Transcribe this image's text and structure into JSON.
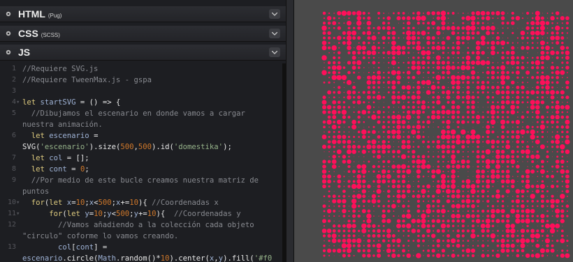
{
  "panels": [
    {
      "title": "HTML",
      "sub": "(Pug)"
    },
    {
      "title": "CSS",
      "sub": "(SCSS)"
    },
    {
      "title": "JS",
      "sub": ""
    }
  ],
  "code_lines": [
    {
      "n": "1",
      "fold": "",
      "tokens": [
        [
          "c",
          "//Requiere SVG.js"
        ]
      ]
    },
    {
      "n": "2",
      "fold": "",
      "tokens": [
        [
          "c",
          "//Requiere TweenMax.js - gspa"
        ]
      ]
    },
    {
      "n": "3",
      "fold": "",
      "tokens": []
    },
    {
      "n": "4",
      "fold": "▾",
      "tokens": [
        [
          "k",
          "let "
        ],
        [
          "v",
          "startSVG"
        ],
        [
          "p",
          " = () => {"
        ]
      ]
    },
    {
      "n": "5",
      "fold": "",
      "tokens": [
        [
          "c",
          "  //Dibujamos el escenario en donde vamos a cargar"
        ]
      ]
    },
    {
      "n": "",
      "fold": "",
      "tokens": [
        [
          "c",
          "nuestra animación."
        ]
      ]
    },
    {
      "n": "6",
      "fold": "",
      "tokens": [
        [
          "k",
          "  let "
        ],
        [
          "v",
          "escenario"
        ],
        [
          "p",
          " ="
        ]
      ]
    },
    {
      "n": "",
      "fold": "",
      "tokens": [
        [
          "p",
          "SVG("
        ],
        [
          "s",
          "'escenario'"
        ],
        [
          "p",
          ").size("
        ],
        [
          "n",
          "500"
        ],
        [
          "p",
          ","
        ],
        [
          "n",
          "500"
        ],
        [
          "p",
          ").id("
        ],
        [
          "s",
          "'domestika'"
        ],
        [
          "p",
          ");"
        ]
      ]
    },
    {
      "n": "7",
      "fold": "",
      "tokens": [
        [
          "k",
          "  let "
        ],
        [
          "v",
          "col"
        ],
        [
          "p",
          " = [];"
        ]
      ]
    },
    {
      "n": "8",
      "fold": "",
      "tokens": [
        [
          "k",
          "  let "
        ],
        [
          "v",
          "cont"
        ],
        [
          "p",
          " = "
        ],
        [
          "n",
          "0"
        ],
        [
          "p",
          ";"
        ]
      ]
    },
    {
      "n": "9",
      "fold": "",
      "tokens": [
        [
          "c",
          "  //Por medio de este bucle creamos nuestra matriz de"
        ]
      ]
    },
    {
      "n": "",
      "fold": "",
      "tokens": [
        [
          "c",
          "puntos"
        ]
      ]
    },
    {
      "n": "10",
      "fold": "▾",
      "tokens": [
        [
          "k",
          "  for"
        ],
        [
          "p",
          "("
        ],
        [
          "k",
          "let "
        ],
        [
          "v",
          "x"
        ],
        [
          "p",
          "="
        ],
        [
          "n",
          "10"
        ],
        [
          "p",
          ";"
        ],
        [
          "v",
          "x"
        ],
        [
          "p",
          "<"
        ],
        [
          "n",
          "500"
        ],
        [
          "p",
          ";"
        ],
        [
          "v",
          "x"
        ],
        [
          "p",
          "+="
        ],
        [
          "n",
          "10"
        ],
        [
          "p",
          "){ "
        ],
        [
          "c",
          "//Coordenadas x"
        ]
      ]
    },
    {
      "n": "11",
      "fold": "▾",
      "tokens": [
        [
          "k",
          "      for"
        ],
        [
          "p",
          "("
        ],
        [
          "k",
          "let "
        ],
        [
          "v",
          "y"
        ],
        [
          "p",
          "="
        ],
        [
          "n",
          "10"
        ],
        [
          "p",
          ";"
        ],
        [
          "v",
          "y"
        ],
        [
          "p",
          "<"
        ],
        [
          "n",
          "500"
        ],
        [
          "p",
          ";"
        ],
        [
          "v",
          "y"
        ],
        [
          "p",
          "+="
        ],
        [
          "n",
          "10"
        ],
        [
          "p",
          "){  "
        ],
        [
          "c",
          "//Coordenadas y"
        ]
      ]
    },
    {
      "n": "12",
      "fold": "",
      "tokens": [
        [
          "c",
          "        //Vamos añadiendo a la colección cada objeto"
        ]
      ]
    },
    {
      "n": "",
      "fold": "",
      "tokens": [
        [
          "c",
          "\"circulo\" coforme lo vamos creando."
        ]
      ]
    },
    {
      "n": "13",
      "fold": "",
      "tokens": [
        [
          "v",
          "        col"
        ],
        [
          "p",
          "["
        ],
        [
          "v",
          "cont"
        ],
        [
          "p",
          "] ="
        ]
      ]
    },
    {
      "n": "",
      "fold": "",
      "tokens": [
        [
          "v",
          "escenario"
        ],
        [
          "p",
          ".circle("
        ],
        [
          "v",
          "Math"
        ],
        [
          "p",
          ".random()*"
        ],
        [
          "n",
          "10"
        ],
        [
          "p",
          ").center("
        ],
        [
          "v",
          "x"
        ],
        [
          "p",
          ","
        ],
        [
          "v",
          "y"
        ],
        [
          "p",
          ").fill("
        ],
        [
          "s",
          "'#f0"
        ]
      ]
    }
  ],
  "dot_color": "#ff0f5a",
  "preview_bg": "#4a4a4a"
}
